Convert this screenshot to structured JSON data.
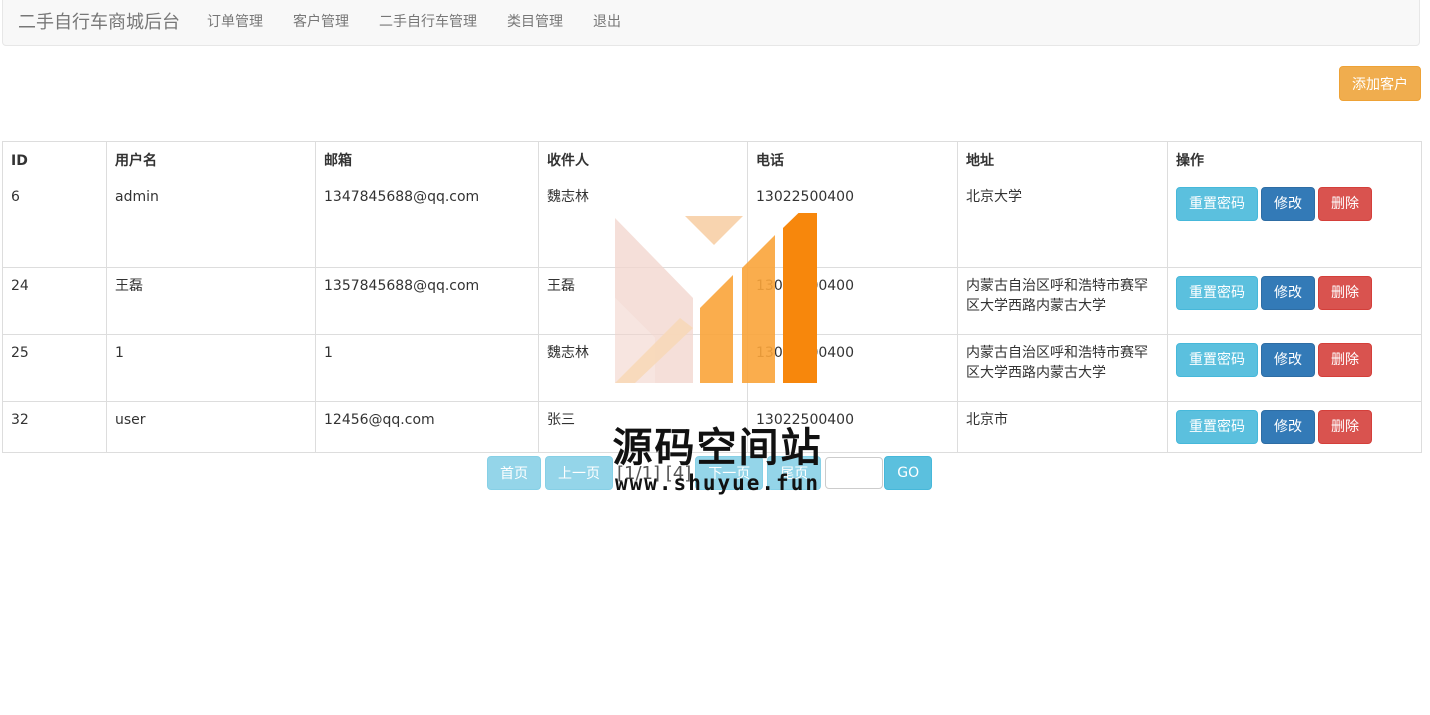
{
  "navbar": {
    "brand": "二手自行车商城后台",
    "items": [
      {
        "label": "订单管理"
      },
      {
        "label": "客户管理"
      },
      {
        "label": "二手自行车管理"
      },
      {
        "label": "类目管理"
      },
      {
        "label": "退出"
      }
    ]
  },
  "toolbar": {
    "add_label": "添加客户"
  },
  "table": {
    "headers": [
      "ID",
      "用户名",
      "邮箱",
      "收件人",
      "电话",
      "地址",
      "操作"
    ],
    "rows": [
      {
        "id": "6",
        "username": "admin",
        "email": "1347845688@qq.com",
        "receiver": "魏志林",
        "phone": "13022500400",
        "address": "北京大学"
      },
      {
        "id": "24",
        "username": "王磊",
        "email": "1357845688@qq.com",
        "receiver": "王磊",
        "phone": "13022500400",
        "address": "内蒙古自治区呼和浩特市赛罕区大学西路内蒙古大学"
      },
      {
        "id": "25",
        "username": "1",
        "email": "1",
        "receiver": "魏志林",
        "phone": "13022500400",
        "address": "内蒙古自治区呼和浩特市赛罕区大学西路内蒙古大学"
      },
      {
        "id": "32",
        "username": "user",
        "email": "12456@qq.com",
        "receiver": "张三",
        "phone": "13022500400",
        "address": "北京市"
      }
    ],
    "actions": {
      "reset": "重置密码",
      "edit": "修改",
      "delete": "删除"
    }
  },
  "pager": {
    "first": "首页",
    "prev": "上一页",
    "info": "[1/1] [4]",
    "next": "下一页",
    "last": "尾页",
    "input_value": "",
    "go": "GO"
  },
  "watermark": {
    "title": "源码空间站",
    "url": "www.shuyue.fun",
    "colors": {
      "light": "#f2d4cc",
      "orange": "#f9a43a",
      "dark_orange": "#f7870c"
    }
  }
}
